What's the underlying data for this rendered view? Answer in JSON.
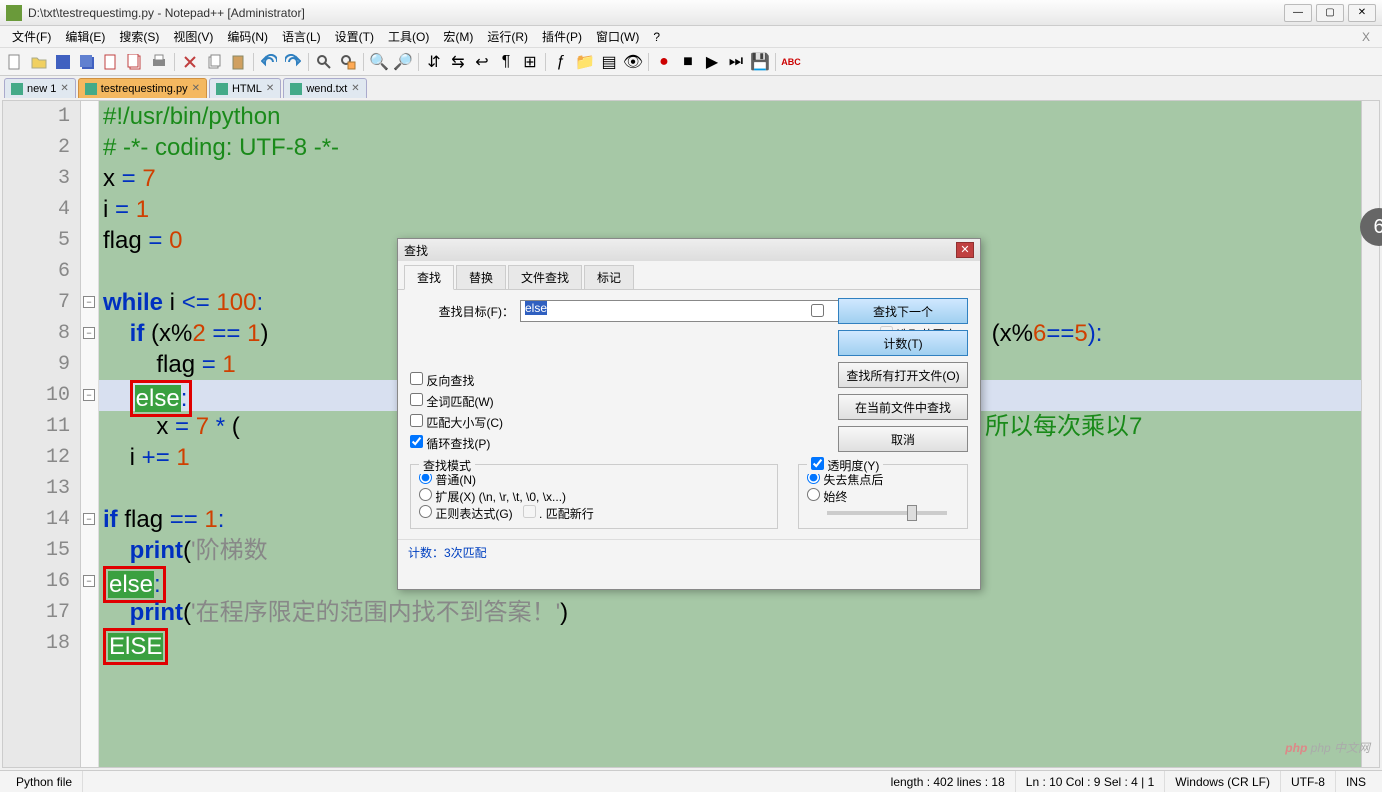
{
  "title": "D:\\txt\\testrequestimg.py - Notepad++ [Administrator]",
  "menu": [
    "文件(F)",
    "编辑(E)",
    "搜索(S)",
    "视图(V)",
    "编码(N)",
    "语言(L)",
    "设置(T)",
    "工具(O)",
    "宏(M)",
    "运行(R)",
    "插件(P)",
    "窗口(W)",
    "?"
  ],
  "tabs": [
    {
      "label": "new 1",
      "active": false
    },
    {
      "label": "testrequestimg.py",
      "active": true
    },
    {
      "label": "HTML",
      "active": false
    },
    {
      "label": "wend.txt",
      "active": false
    }
  ],
  "code": {
    "1": "#!/usr/bin/python",
    "2": "# -*- coding: UTF-8 -*-",
    "3a": "x ",
    "3b": "=",
    "3c": " ",
    "3d": "7",
    "4a": "i ",
    "4b": "=",
    "4c": " ",
    "4d": "1",
    "5a": "flag ",
    "5b": "=",
    "5c": " ",
    "5d": "0",
    "7a": "while",
    "7b": " i ",
    "7c": "<=",
    "7d": " ",
    "7e": "100",
    "7f": ":",
    "8a": "    ",
    "8b": "if",
    "8c": " (x%",
    "8d": "2",
    "8e": " ",
    "8f": "==",
    "8g": " ",
    "8h": "1",
    "8i": ")",
    "8j": " (x%",
    "8k": "6",
    "8l": "==",
    "8m": "5",
    "8n": "):",
    "9a": "        flag ",
    "9b": "=",
    "9c": " ",
    "9d": "1",
    "10a": "    ",
    "10b": "else",
    "10c": ":",
    "11a": "        x ",
    "11b": "=",
    "11c": " ",
    "11d": "7",
    "11e": " ",
    "11f": "*",
    "11g": " (",
    "11h": "所以每次乘以7",
    "12a": "    i ",
    "12b": "+=",
    "12c": " ",
    "12d": "1",
    "14a": "if",
    "14b": " flag ",
    "14c": "==",
    "14d": " ",
    "14e": "1",
    "14f": ":",
    "15a": "    ",
    "15b": "print",
    "15c": "(",
    "15d": "'阶梯数",
    "16a": "else",
    "16b": ":",
    "17a": "    ",
    "17b": "print",
    "17c": "(",
    "17d": "'在程序限定的范围内找不到答案！'",
    "17e": ")",
    "18a": "ElSE"
  },
  "find": {
    "title": "查找",
    "tabs": [
      "查找",
      "替换",
      "文件查找",
      "标记"
    ],
    "target_label": "查找目标(F)：",
    "target_value": "else",
    "in_selection": "选取范围内(I)",
    "btn_next": "查找下一个",
    "btn_count": "计数(T)",
    "btn_all_open": "查找所有打开文件(O)",
    "btn_current": "在当前文件中查找",
    "btn_cancel": "取消",
    "opt_reverse": "反向查找",
    "opt_whole": "全词匹配(W)",
    "opt_case": "匹配大小写(C)",
    "opt_wrap": "循环查找(P)",
    "mode_title": "查找模式",
    "mode_normal": "普通(N)",
    "mode_ext": "扩展(X) (\\n, \\r, \\t, \\0, \\x...)",
    "mode_regex": "正则表达式(G)",
    "mode_dotall": ". 匹配新行",
    "trans_title": "透明度(Y)",
    "trans_lostfocus": "失去焦点后",
    "trans_always": "始终",
    "status": "计数：3次匹配"
  },
  "status": {
    "lang": "Python file",
    "length": "length : 402    lines : 18",
    "pos": "Ln : 10    Col : 9    Sel : 4 | 1",
    "eol": "Windows (CR LF)",
    "enc": "UTF-8",
    "ins": "INS"
  },
  "watermark": "php 中文网",
  "badge": "6"
}
